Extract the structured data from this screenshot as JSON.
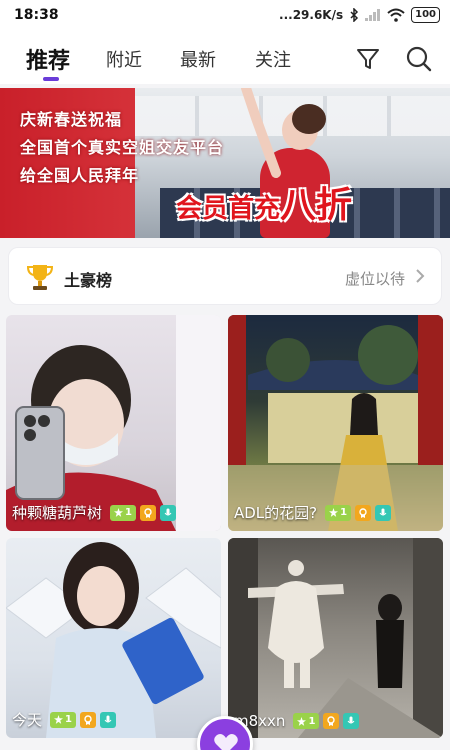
{
  "status_bar": {
    "time": "18:38",
    "network_speed": "...29.6K/s",
    "battery": "100"
  },
  "tabs": [
    {
      "label": "推荐",
      "active": true
    },
    {
      "label": "附近",
      "active": false
    },
    {
      "label": "最新",
      "active": false
    },
    {
      "label": "关注",
      "active": false
    }
  ],
  "banner": {
    "line1": "庆新春送祝福",
    "line2": "全国首个真实空姐交友平台",
    "line3": "给全国人民拜年",
    "promo_prefix": "会员首充",
    "promo_highlight": "八折"
  },
  "leaderboard": {
    "title": "土豪榜",
    "status": "虚位以待"
  },
  "cards": [
    {
      "name": "种颗糖葫芦树",
      "level": "1"
    },
    {
      "name": "ADL的花园?",
      "level": "1"
    },
    {
      "name": "今天",
      "level": "1"
    },
    {
      "name": "m8xxn",
      "level": "1"
    }
  ],
  "colors": {
    "accent": "#6a3cd8",
    "level_badge": "#9ad24a",
    "vip_badge": "#f2a71e",
    "voice_badge": "#34c7b4"
  }
}
